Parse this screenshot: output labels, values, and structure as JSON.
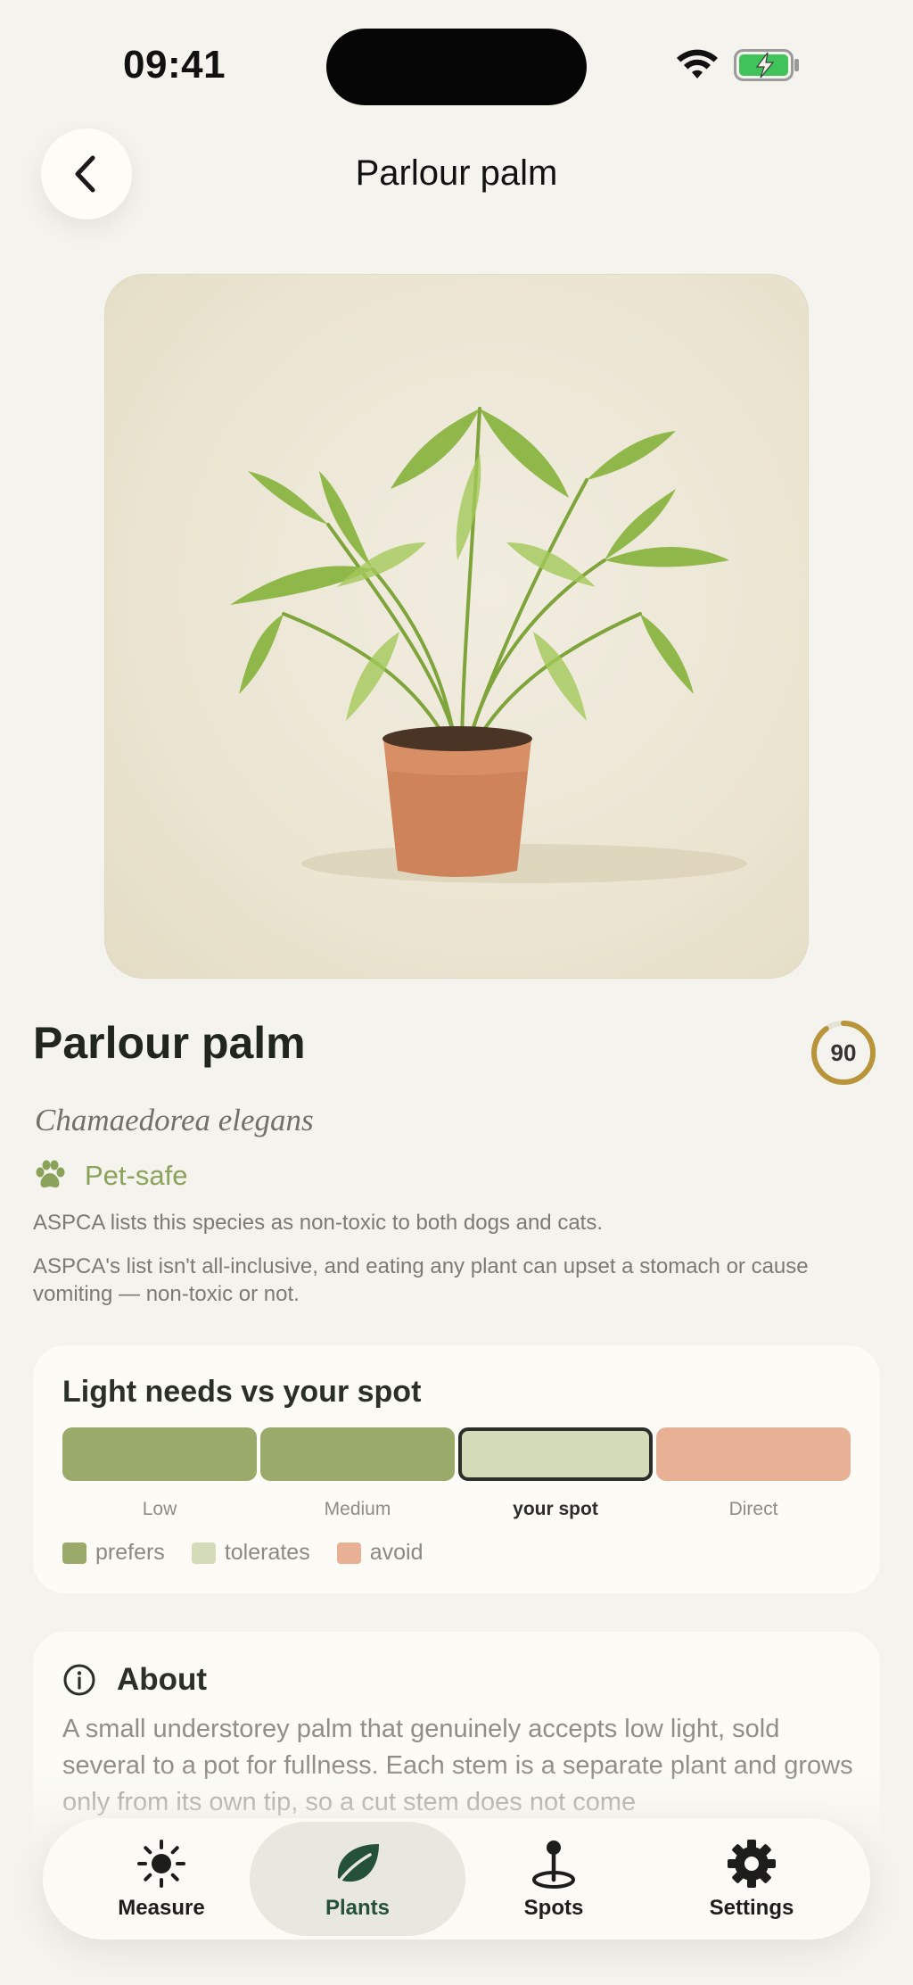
{
  "status_bar": {
    "time": "09:41"
  },
  "header": {
    "title": "Parlour palm"
  },
  "plant": {
    "name": "Parlour palm",
    "latin_name": "Chamaedorea elegans",
    "score": "90",
    "score_fraction": 0.9,
    "pet_label": "Pet-safe",
    "pet_note": "ASPCA lists this species as non-toxic to both dogs and cats.",
    "pet_disclaimer": "ASPCA's list isn't all-inclusive, and eating any plant can upset a stomach or cause vomiting — non-toxic or not."
  },
  "light_card": {
    "title": "Light needs vs your spot",
    "levels": [
      {
        "label": "Low",
        "status": "prefers"
      },
      {
        "label": "Medium",
        "status": "prefers"
      },
      {
        "label": "your spot",
        "status": "tolerates",
        "current": true
      },
      {
        "label": "Direct",
        "status": "avoid"
      }
    ],
    "legend": [
      {
        "label": "prefers",
        "color": "#9aaa6a"
      },
      {
        "label": "tolerates",
        "color": "#d3dbb8"
      },
      {
        "label": "avoid",
        "color": "#e8b094"
      }
    ]
  },
  "about": {
    "title": "About",
    "text": "A small understorey palm that genuinely accepts low light, sold several to a pot for fullness. Each stem is a separate plant and grows only from its own tip, so a cut stem does not come"
  },
  "tabs": [
    {
      "label": "Measure",
      "icon": "sun-icon",
      "active": false
    },
    {
      "label": "Plants",
      "icon": "leaf-icon",
      "active": true
    },
    {
      "label": "Spots",
      "icon": "pin-icon",
      "active": false
    },
    {
      "label": "Settings",
      "icon": "gear-icon",
      "active": false
    }
  ],
  "colors": {
    "accent": "#25503a",
    "pet_safe": "#8aa25a",
    "score_ring": "#b8943a"
  }
}
